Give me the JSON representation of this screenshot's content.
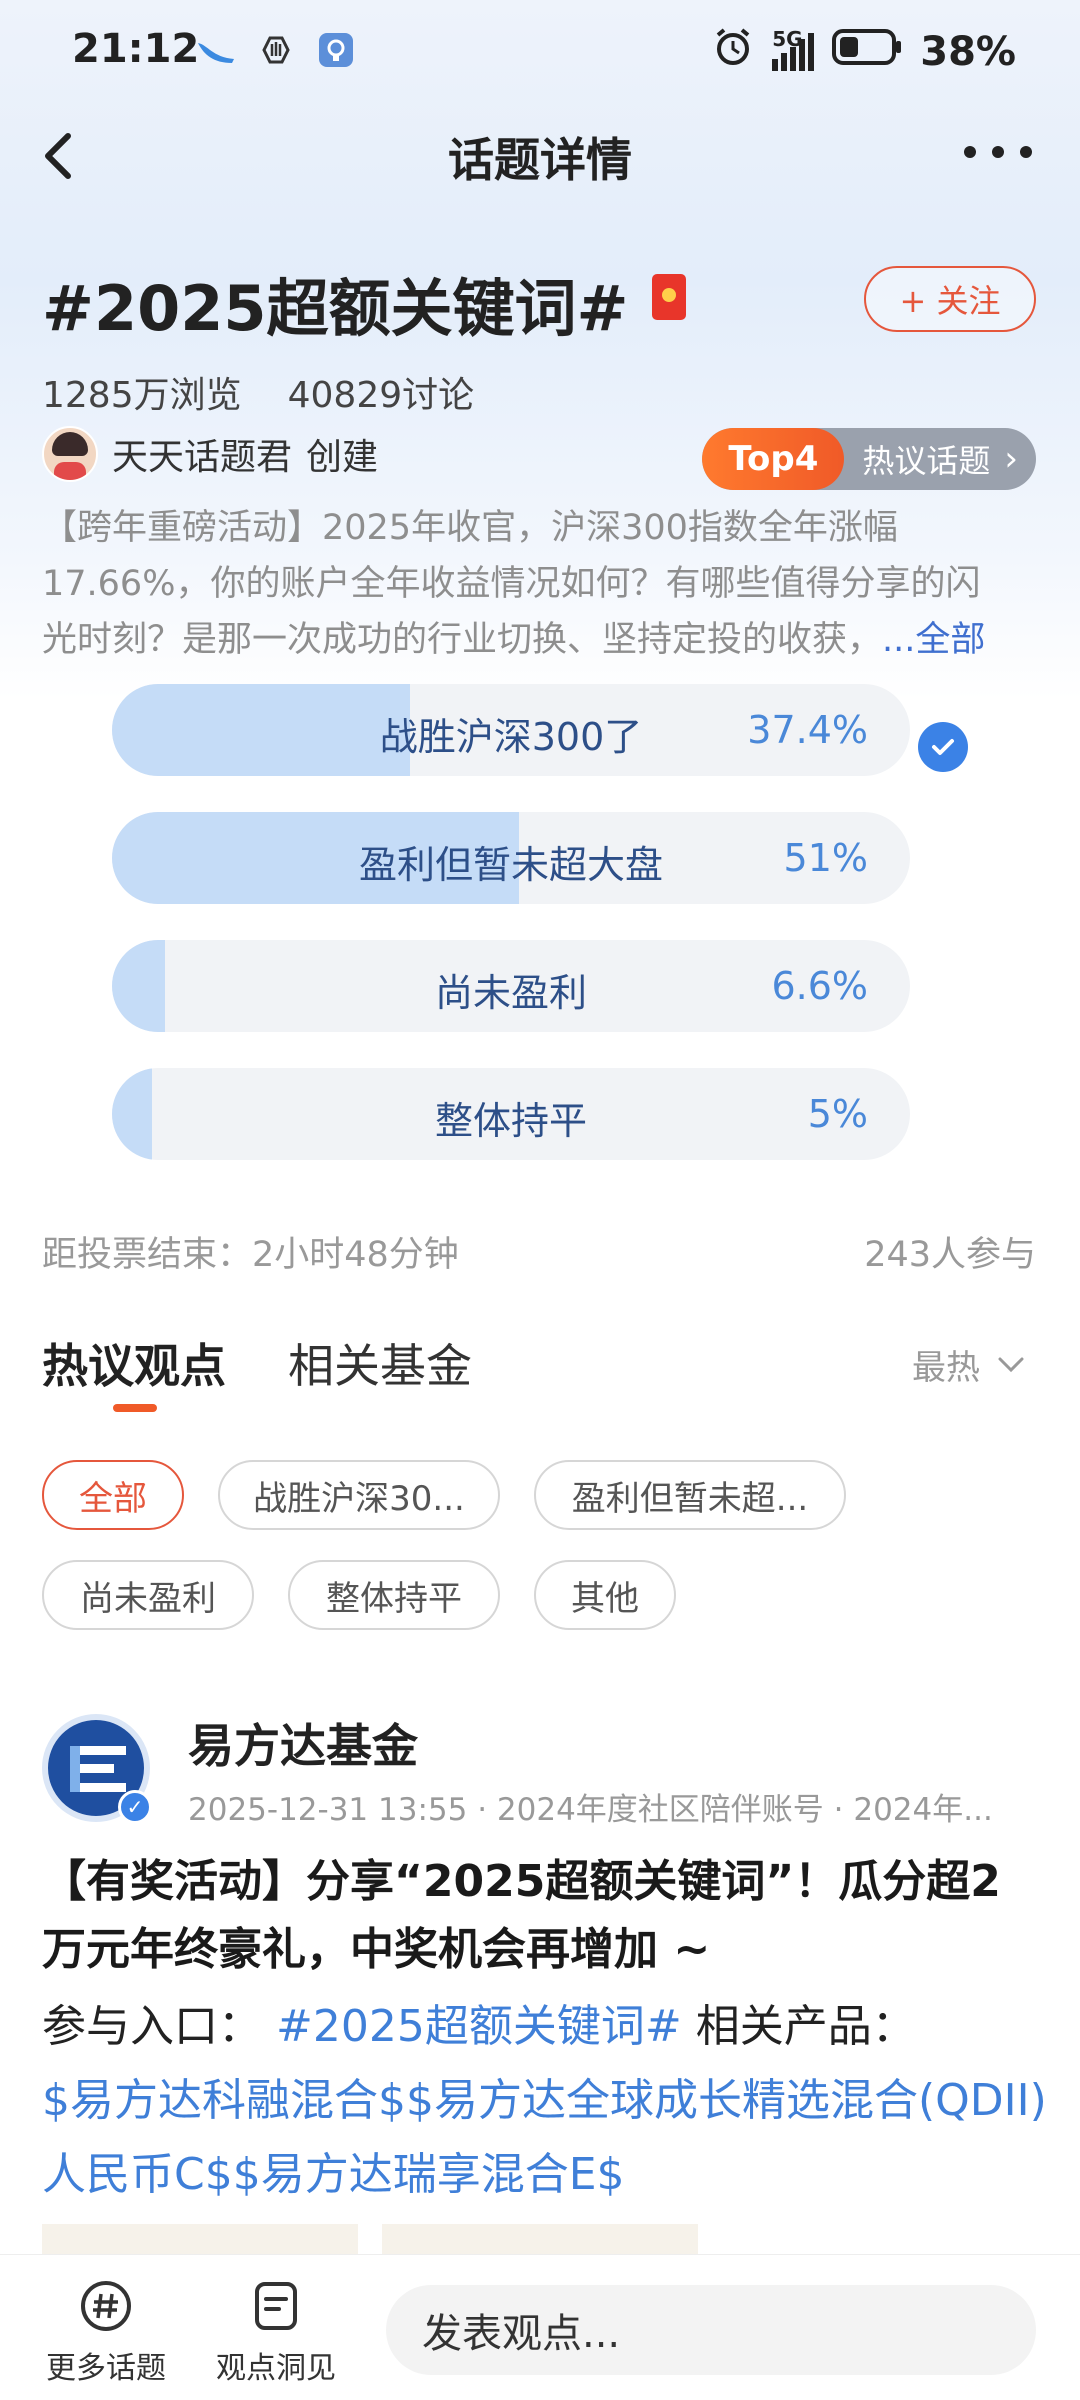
{
  "status_bar": {
    "time": "21:12",
    "network": "5G",
    "battery": "38%",
    "icons": [
      "bird-icon",
      "hand-icon",
      "app-icon",
      "alarm-icon",
      "signal-icon",
      "battery-icon"
    ]
  },
  "header": {
    "title": "话题详情",
    "back_icon": "chevron-left-icon",
    "more_icon": "more-dots-icon"
  },
  "topic": {
    "title": "#2025超额关键词#",
    "follow_label": "+ 关注",
    "views": "1285万浏览",
    "discussions": "40829讨论",
    "creator_name": "天天话题君",
    "creator_suffix": "创建",
    "rank_badge": "Top4",
    "rank_label": "热议话题",
    "description_lines": [
      "【跨年重磅活动】2025年收官，沪深300指数全年涨幅",
      "17.66%，你的账户全年收益情况如何？有哪些值得分享的闪",
      "光时刻？是那一次成功的行业切换、坚持定投的收获，"
    ],
    "description_more": "...全部"
  },
  "poll": {
    "options": [
      {
        "label": "战胜沪深300了",
        "percent": "37.4%",
        "value": 37.4,
        "selected": true
      },
      {
        "label": "盈利但暂未超大盘",
        "percent": "51%",
        "value": 51,
        "selected": false
      },
      {
        "label": "尚未盈利",
        "percent": "6.6%",
        "value": 6.6,
        "selected": false
      },
      {
        "label": "整体持平",
        "percent": "5%",
        "value": 5,
        "selected": false
      }
    ],
    "end_text": "距投票结束：2小时48分钟",
    "participants": "243人参与"
  },
  "tabs": {
    "items": [
      "热议观点",
      "相关基金"
    ],
    "active": 0,
    "sort_label": "最热"
  },
  "filters": {
    "chips": [
      "全部",
      "战胜沪深30...",
      "盈利但暂未超...",
      "尚未盈利",
      "整体持平",
      "其他"
    ],
    "active": 0
  },
  "post": {
    "author": "易方达基金",
    "meta": "2025-12-31 13:55 · 2024年度社区陪伴账号 · 2024年...",
    "title": "【有奖活动】分享“2025超额关键词”！瓜分超2万元年终豪礼，中奖机会再增加 ~",
    "entry_label": "参与入口：",
    "entry_topic": "#2025超额关键词#",
    "products_label": "相关产品：",
    "products_links": "$易方达科融混合$$易方达全球成长精选混合(QDII)人民币C$$易方达瑞享混合E$"
  },
  "bottom_bar": {
    "more_topics": "更多话题",
    "insights": "观点洞见",
    "comment_placeholder": "发表观点..."
  },
  "colors": {
    "accent_orange": "#f05a28",
    "poll_fill": "#c5dcf7",
    "link_blue": "#3f7fd8",
    "check_blue": "#3b82e6"
  }
}
